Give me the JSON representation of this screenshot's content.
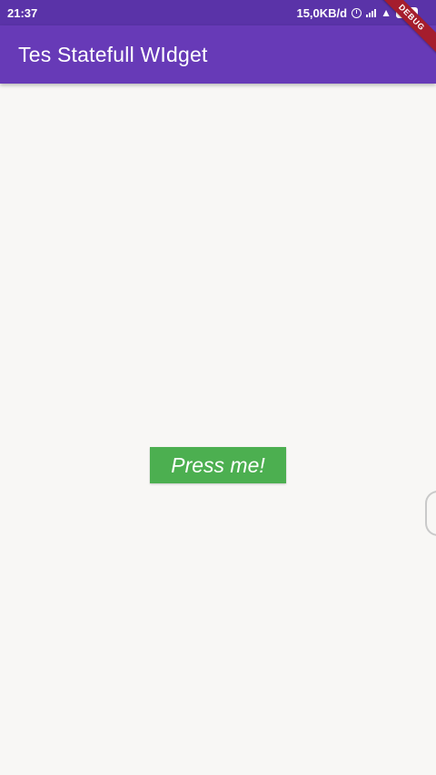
{
  "status_bar": {
    "time": "21:37",
    "network_speed": "15,0KB/d",
    "battery_level": "84",
    "alarm_icon": "alarm-clock-icon",
    "signal_icon": "cellular-signal-icon",
    "wifi_icon": "wifi-icon"
  },
  "app_bar": {
    "title": "Tes Statefull WIdget"
  },
  "debug_banner": {
    "label": "DEBUG"
  },
  "main": {
    "button_label": "Press me!"
  },
  "colors": {
    "app_bar": "#673ab7",
    "status_bar": "#5a33a8",
    "button": "#4caf50",
    "debug_banner": "#a51d2d",
    "background": "#f8f7f5"
  }
}
